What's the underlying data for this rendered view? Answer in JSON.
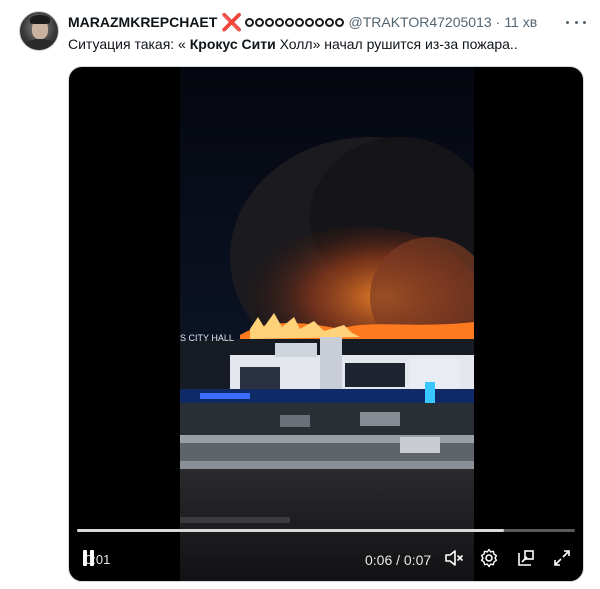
{
  "tweet": {
    "display_name": "MARAZMKREPCHAET",
    "name_emoji": "❌",
    "handle": "@TRAKTOR47205013",
    "separator": "·",
    "time": "11 хв",
    "text_before": "Ситуация такая: « ",
    "text_bold": "Крокус Сити",
    "text_after": " Холл» начал рушится из-за пожара.."
  },
  "video": {
    "elapsed_short": "0:01",
    "time_display": "0:06 / 0:07",
    "progress": 0.857,
    "frame_sign": "S CITY HALL"
  },
  "colors": {
    "accent_red": "#d92a2a",
    "muted_text": "#536471",
    "video_bg": "#000000"
  },
  "icons": {
    "more": "more-dots-icon",
    "pause": "pause-icon",
    "mute": "volume-muted-icon",
    "settings": "gear-icon",
    "pip": "picture-in-picture-icon",
    "fullscreen": "expand-icon"
  }
}
